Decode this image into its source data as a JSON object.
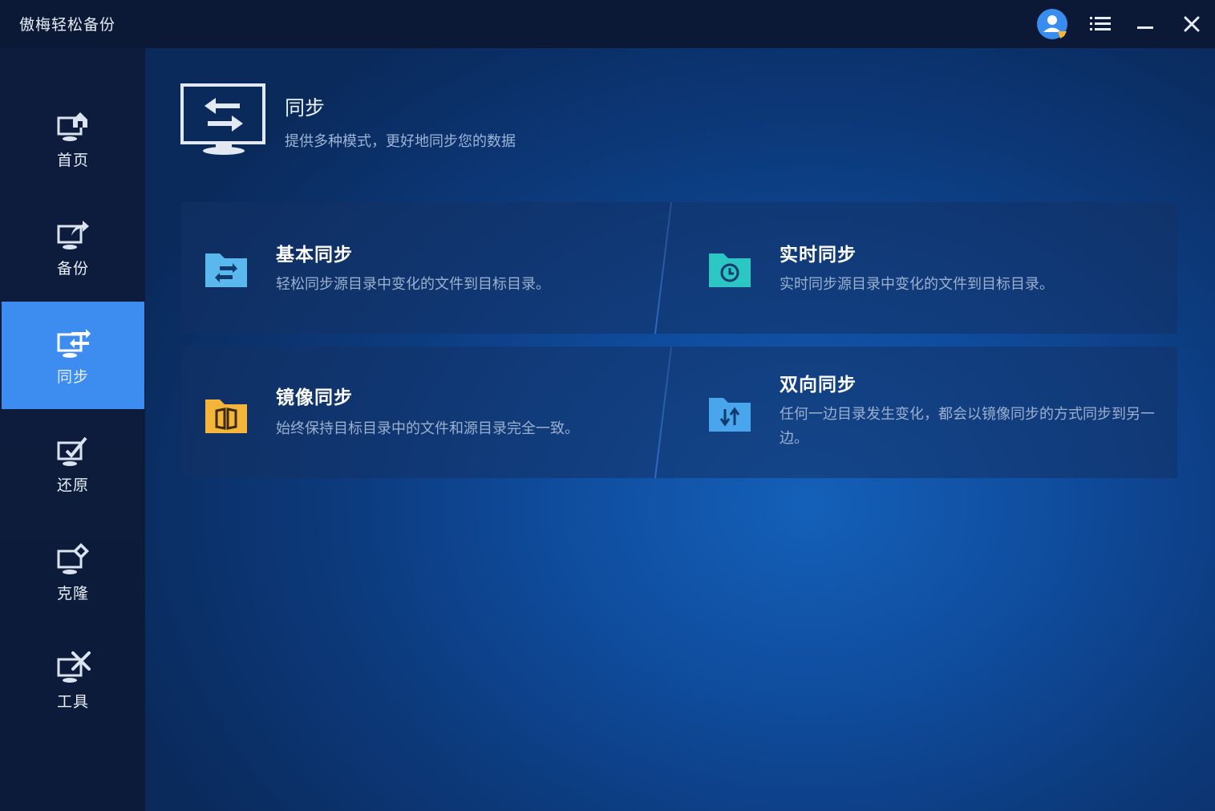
{
  "app": {
    "title": "傲梅轻松备份"
  },
  "titlebar": {
    "user_icon": "user-avatar-icon",
    "menu_icon": "menu-list-icon",
    "minimize_icon": "minimize-icon",
    "close_icon": "close-icon"
  },
  "sidebar": {
    "items": [
      {
        "label": "首页",
        "icon": "home-monitor-icon",
        "active": false
      },
      {
        "label": "备份",
        "icon": "backup-monitor-icon",
        "active": false
      },
      {
        "label": "同步",
        "icon": "sync-monitor-icon",
        "active": true
      },
      {
        "label": "还原",
        "icon": "restore-monitor-icon",
        "active": false
      },
      {
        "label": "克隆",
        "icon": "clone-monitor-icon",
        "active": false
      },
      {
        "label": "工具",
        "icon": "tools-monitor-icon",
        "active": false
      }
    ]
  },
  "main": {
    "title": "同步",
    "subtitle": "提供多种模式，更好地同步您的数据",
    "cards": [
      {
        "title": "基本同步",
        "desc": "轻松同步源目录中变化的文件到目标目录。",
        "icon": "basic-sync-folder-icon"
      },
      {
        "title": "实时同步",
        "desc": "实时同步源目录中变化的文件到目标目录。",
        "icon": "realtime-sync-folder-icon"
      },
      {
        "title": "镜像同步",
        "desc": "始终保持目标目录中的文件和源目录完全一致。",
        "icon": "mirror-sync-folder-icon"
      },
      {
        "title": "双向同步",
        "desc": "任何一边目录发生变化，都会以镜像同步的方式同步到另一边。",
        "icon": "two-way-sync-folder-icon"
      }
    ]
  },
  "colors": {
    "accent": "#3d8cf0",
    "basic_icon": "#5ab8ee",
    "realtime_icon": "#2cc7c3",
    "mirror_icon": "#f3b63a",
    "twoway_icon": "#4aa6ec"
  }
}
